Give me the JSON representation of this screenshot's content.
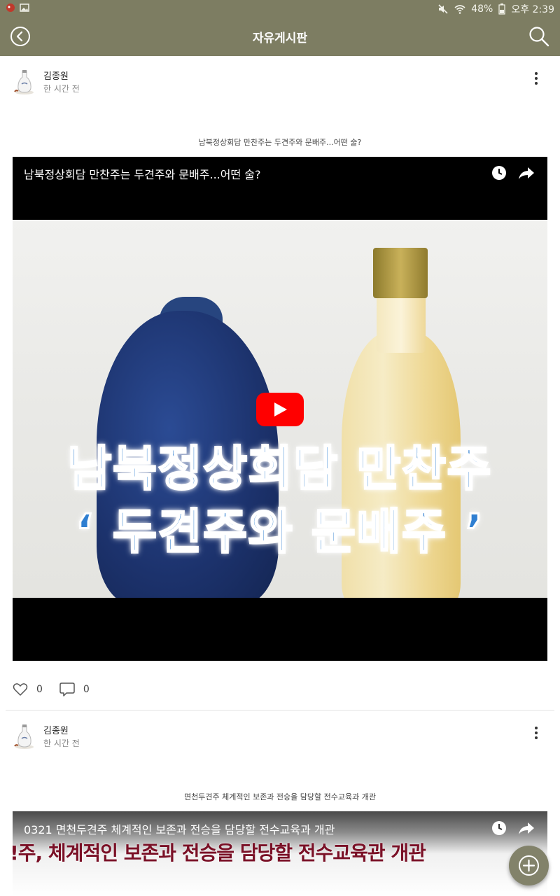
{
  "status_bar": {
    "battery": "48%",
    "time": "오후 2:39"
  },
  "header": {
    "title": "자유게시판"
  },
  "posts": [
    {
      "author": "김종원",
      "time": "한 시간 전",
      "caption": "남북정상회담 만찬주는 두견주와 문배주...어떤 술?",
      "video": {
        "title": "남북정상회담 만찬주는 두견주와 문배주...어떤 술?",
        "thumbnail_line1": "남북정상회담 만찬주",
        "thumbnail_line2": "‘ 두견주와 문배주 ’"
      },
      "likes": "0",
      "comments": "0"
    },
    {
      "author": "김종원",
      "time": "한 시간 전",
      "caption": "면천두견주 체계적인 보존과 전승을 담당할 전수교육과 개관",
      "video": {
        "title": "0321 면천두견주 체계적인 보존과 전승을 담당할 전수교육과 개관",
        "banner": "!주, 체계적인 보존과 전승을 담당할 전수교육관 개관"
      }
    }
  ],
  "icons": {
    "back": "back-arrow-icon",
    "search": "search-icon",
    "more": "more-vertical-icon",
    "like": "heart-icon",
    "comment": "comment-icon",
    "watch_later": "clock-icon",
    "share": "share-icon",
    "play": "play-icon",
    "add": "add-icon"
  },
  "colors": {
    "header": "#7d7d62",
    "fab": "#82826a",
    "play": "#ff0000"
  }
}
